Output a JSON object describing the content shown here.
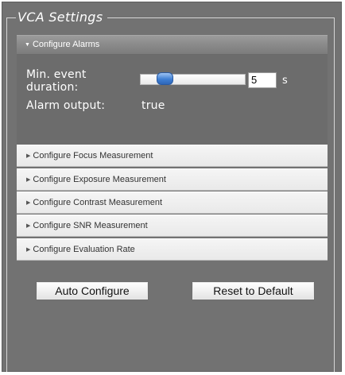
{
  "panel": {
    "title": "VCA Settings"
  },
  "alarms": {
    "header": "Configure Alarms",
    "min_event_label": "Min. event duration:",
    "min_event_value": "5",
    "min_event_unit": "s",
    "alarm_output_label": "Alarm output:",
    "alarm_output_value": "true"
  },
  "sections": [
    {
      "label": "Configure Focus Measurement"
    },
    {
      "label": "Configure Exposure Measurement"
    },
    {
      "label": "Configure Contrast Measurement"
    },
    {
      "label": "Configure SNR Measurement"
    },
    {
      "label": "Configure Evaluation Rate"
    }
  ],
  "buttons": {
    "auto_configure": "Auto Configure",
    "reset_default": "Reset to Default"
  },
  "icons": {
    "expanded_arrow": "triangle-down",
    "collapsed_arrow": "triangle-right"
  },
  "colors": {
    "panel_bg": "#727272",
    "slider_thumb": "#3f7fd4"
  }
}
